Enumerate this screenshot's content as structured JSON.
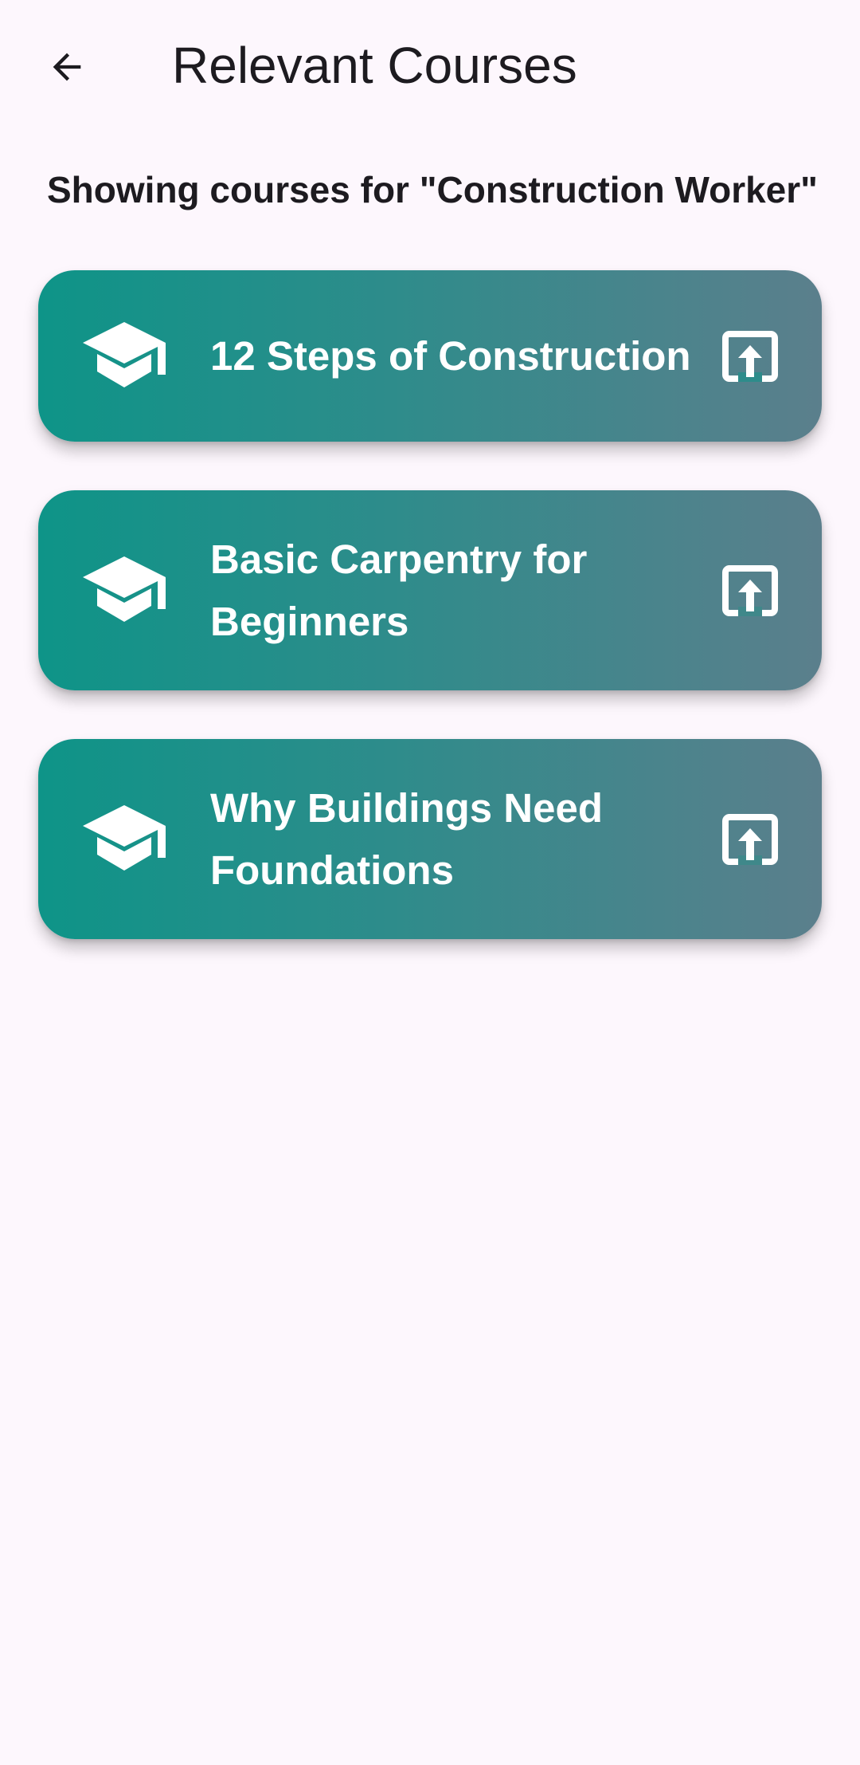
{
  "app_bar": {
    "back_icon": "arrow-back-icon",
    "title": "Relevant Courses"
  },
  "subtitle": "Showing courses for \"Construction Worker\"",
  "theme": {
    "background": "#fdf7fd",
    "card_gradient_start": "#0e9488",
    "card_gradient_end": "#5b7f8c",
    "card_text": "#ffffff"
  },
  "courses": [
    {
      "title": "12 Steps of Construction",
      "leading_icon": "graduation-cap-icon",
      "trailing_icon": "open-in-new-icon"
    },
    {
      "title": "Basic Carpentry for Beginners",
      "leading_icon": "graduation-cap-icon",
      "trailing_icon": "open-in-new-icon"
    },
    {
      "title": "Why Buildings Need Foundations",
      "leading_icon": "graduation-cap-icon",
      "trailing_icon": "open-in-new-icon"
    }
  ]
}
